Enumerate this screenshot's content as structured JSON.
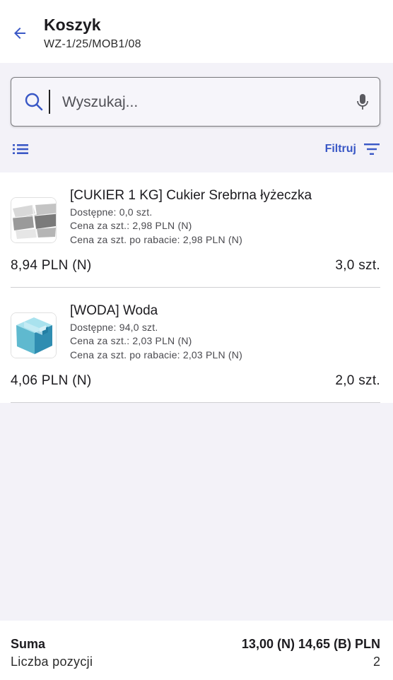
{
  "header": {
    "title": "Koszyk",
    "subtitle": "WZ-1/25/MOB1/08"
  },
  "search": {
    "placeholder": "Wyszukaj..."
  },
  "toolbar": {
    "filter_label": "Filtruj"
  },
  "items": [
    {
      "name": "[CUKIER 1 KG] Cukier Srebrna łyżeczka",
      "available": "Dostępne: 0,0 szt.",
      "unit_price": "Cena za szt.: 2,98 PLN (N)",
      "discount_price": "Cena za szt. po rabacie: 2,98 PLN (N)",
      "total": "8,94 PLN (N)",
      "quantity": "3,0 szt.",
      "image_icon": "sugar-cubes-image"
    },
    {
      "name": "[WODA] Woda",
      "available": "Dostępne: 94,0 szt.",
      "unit_price": "Cena za szt.: 2,03 PLN (N)",
      "discount_price": "Cena za szt. po rabacie: 2,03 PLN (N)",
      "total": "4,06 PLN (N)",
      "quantity": "2,0 szt.",
      "image_icon": "box-image"
    }
  ],
  "footer": {
    "sum_label": "Suma",
    "sum_value": "13,00 (N) 14,65 (B) PLN",
    "count_label": "Liczba pozycji",
    "count_value": "2"
  },
  "colors": {
    "accent": "#3a58c6",
    "background": "#f3f2f8",
    "surface": "#ffffff"
  }
}
